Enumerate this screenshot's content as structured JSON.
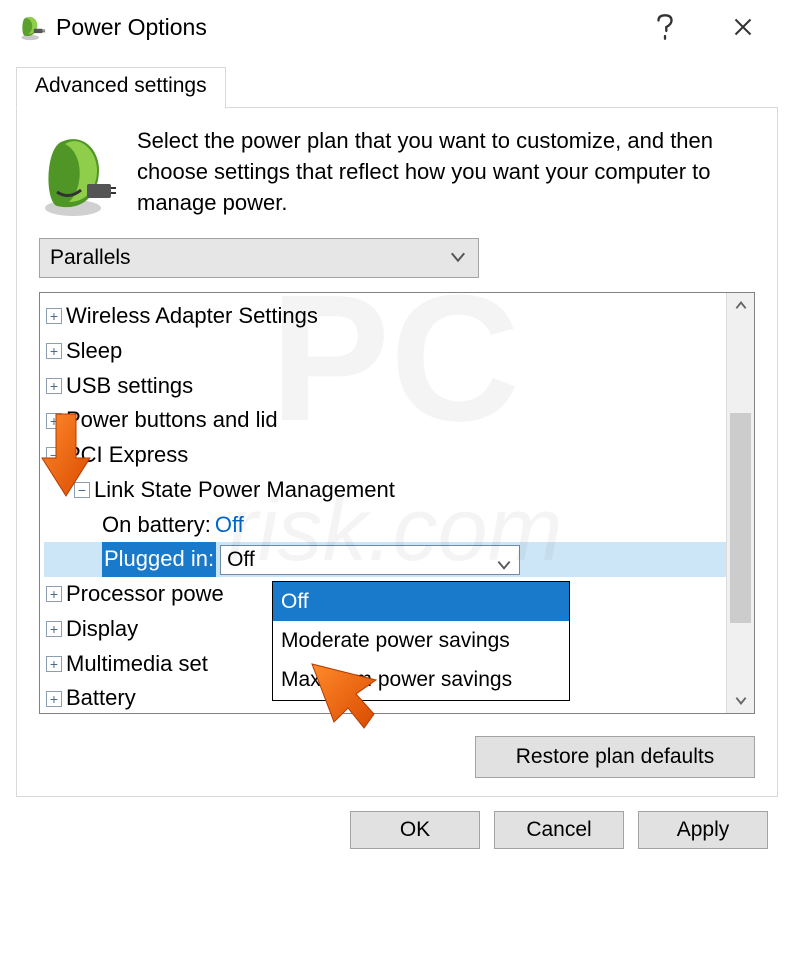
{
  "title": "Power Options",
  "tab_label": "Advanced settings",
  "intro_text": "Select the power plan that you want to customize, and then choose settings that reflect how you want your computer to manage power.",
  "plan_selected": "Parallels",
  "tree": {
    "wireless": "Wireless Adapter Settings",
    "sleep": "Sleep",
    "usb": "USB settings",
    "power_buttons": "Power buttons and lid",
    "pci": "PCI Express",
    "link_state": "Link State Power Management",
    "on_battery_label": "On battery:",
    "on_battery_value": "Off",
    "plugged_in_label": "Plugged in:",
    "plugged_in_value": "Off",
    "processor": "Processor powe",
    "display": "Display",
    "multimedia": "Multimedia set",
    "battery": "Battery"
  },
  "dropdown_options": [
    "Off",
    "Moderate power savings",
    "Maximum power savings"
  ],
  "restore_label": "Restore plan defaults",
  "ok_label": "OK",
  "cancel_label": "Cancel",
  "apply_label": "Apply"
}
